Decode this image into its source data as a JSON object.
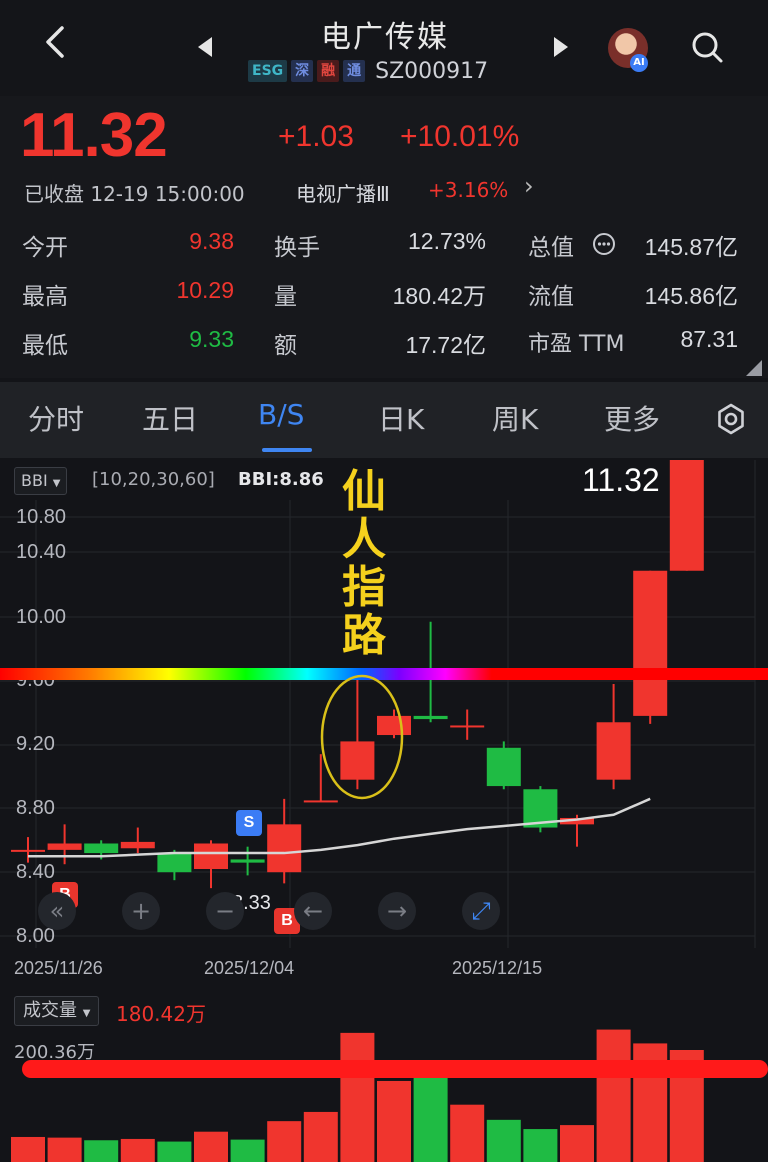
{
  "header": {
    "title": "电广传媒",
    "tags": [
      "ESG",
      "深",
      "融",
      "通"
    ],
    "code": "SZ000917",
    "ai_badge": "AI"
  },
  "quote": {
    "price": "11.32",
    "change": "+1.03",
    "change_pct": "+10.01%",
    "status": "已收盘 12-19 15:00:00",
    "sector": "电视广播Ⅲ",
    "sector_pct": "+3.16%",
    "stats": [
      {
        "label": "今开",
        "value": "9.38"
      },
      {
        "label": "最高",
        "value": "10.29"
      },
      {
        "label": "最低",
        "value": "9.33"
      },
      {
        "label": "换手",
        "value": "12.73%"
      },
      {
        "label": "量",
        "value": "180.42万"
      },
      {
        "label": "额",
        "value": "17.72亿"
      },
      {
        "label": "总值",
        "value": "145.87亿"
      },
      {
        "label": "流值",
        "value": "145.86亿"
      },
      {
        "label": "市盈 TTM",
        "value": "87.31"
      }
    ]
  },
  "tabs": [
    "分时",
    "五日",
    "B/S",
    "日K",
    "周K",
    "更多"
  ],
  "active_tab": "B/S",
  "chart_header": {
    "indicator": "BBI",
    "params": "[10,20,30,60]",
    "bbi_value": "BBI:8.86",
    "last_price": "11.32",
    "annotation": "仙人指路",
    "low_label": "8.33"
  },
  "markers": {
    "buy": "B",
    "sell": "S"
  },
  "volume": {
    "label": "成交量",
    "value": "180.42万",
    "max": "200.36万"
  },
  "colors": {
    "up": "#f0352e",
    "down": "#1fbb44",
    "accent": "#3f86f2",
    "annotation": "#f5d11d"
  },
  "chart_data": {
    "type": "candlestick",
    "x_tick_labels": [
      "2025/11/26",
      "2025/12/04",
      "2025/12/15"
    ],
    "y_ticks": [
      8.0,
      8.4,
      8.8,
      9.2,
      9.6,
      10.0,
      10.4,
      10.8
    ],
    "ylim": [
      8.0,
      11.32
    ],
    "candles": [
      {
        "o": 8.54,
        "c": 8.54,
        "h": 8.62,
        "l": 8.46
      },
      {
        "o": 8.54,
        "c": 8.58,
        "h": 8.7,
        "l": 8.45
      },
      {
        "o": 8.58,
        "c": 8.52,
        "h": 8.6,
        "l": 8.48
      },
      {
        "o": 8.55,
        "c": 8.59,
        "h": 8.68,
        "l": 8.52
      },
      {
        "o": 8.52,
        "c": 8.4,
        "h": 8.54,
        "l": 8.35
      },
      {
        "o": 8.42,
        "c": 8.58,
        "h": 8.6,
        "l": 8.3
      },
      {
        "o": 8.48,
        "c": 8.46,
        "h": 8.56,
        "l": 8.38
      },
      {
        "o": 8.4,
        "c": 8.7,
        "h": 8.86,
        "l": 8.33
      },
      {
        "o": 8.85,
        "c": 8.85,
        "h": 9.14,
        "l": 8.84
      },
      {
        "o": 8.98,
        "c": 9.22,
        "h": 9.64,
        "l": 8.92
      },
      {
        "o": 9.26,
        "c": 9.38,
        "h": 9.42,
        "l": 9.24
      },
      {
        "o": 9.38,
        "c": 9.36,
        "h": 9.97,
        "l": 9.34
      },
      {
        "o": 9.32,
        "c": 9.32,
        "h": 9.42,
        "l": 9.23
      },
      {
        "o": 9.18,
        "c": 8.94,
        "h": 9.22,
        "l": 8.92
      },
      {
        "o": 8.92,
        "c": 8.68,
        "h": 8.94,
        "l": 8.65
      },
      {
        "o": 8.7,
        "c": 8.74,
        "h": 8.76,
        "l": 8.56
      },
      {
        "o": 8.98,
        "c": 9.34,
        "h": 9.58,
        "l": 8.92
      },
      {
        "o": 9.38,
        "c": 10.29,
        "h": 10.29,
        "l": 9.33
      },
      {
        "o": 10.29,
        "c": 11.32,
        "h": 11.32,
        "l": 10.29
      }
    ],
    "bbi": [
      8.5,
      8.5,
      8.5,
      8.51,
      8.52,
      8.52,
      8.52,
      8.52,
      8.54,
      8.57,
      8.61,
      8.64,
      8.67,
      8.69,
      8.71,
      8.73,
      8.76,
      8.86
    ],
    "volume": [
      38,
      37,
      33,
      35,
      31,
      46,
      34,
      62,
      76,
      196,
      123,
      134,
      87,
      64,
      50,
      56,
      201,
      180,
      170
    ],
    "volume_max": 200.36
  }
}
